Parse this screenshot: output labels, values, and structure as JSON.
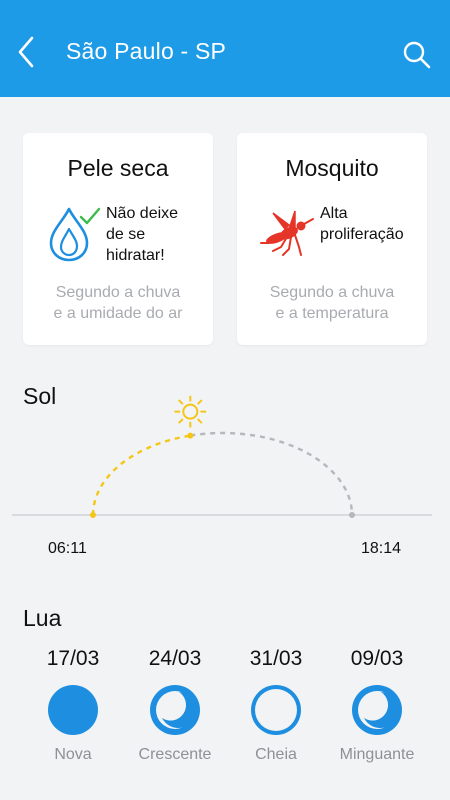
{
  "header": {
    "title": "São Paulo - SP",
    "back_icon": "chevron-left-icon",
    "search_icon": "search-icon",
    "background": "#1e9be6"
  },
  "cards": [
    {
      "title": "Pele seca",
      "icon": "water-drop-check-icon",
      "message": [
        "Não deixe",
        "de se",
        "hidratar!"
      ],
      "subtitle": [
        "Segundo a chuva",
        "e a umidade do ar"
      ]
    },
    {
      "title": "Mosquito",
      "icon": "mosquito-icon",
      "message": [
        "Alta",
        "proliferação"
      ],
      "subtitle": [
        "Segundo a chuva",
        "e a temperatura"
      ]
    }
  ],
  "sun": {
    "title": "Sol",
    "sunrise": "06:11",
    "sunset": "18:14",
    "day_progress": 0.42,
    "elapsed_color": "#f5c518",
    "remaining_color": "#b4b7bb"
  },
  "moon": {
    "title": "Lua",
    "phases": [
      {
        "date": "17/03",
        "label": "Nova",
        "icon": "new-moon-icon"
      },
      {
        "date": "24/03",
        "label": "Crescente",
        "icon": "crescent-moon-icon"
      },
      {
        "date": "31/03",
        "label": "Cheia",
        "icon": "full-moon-icon"
      },
      {
        "date": "09/03",
        "label": "Minguante",
        "icon": "waning-moon-icon"
      }
    ],
    "color": "#1e8fe0"
  }
}
